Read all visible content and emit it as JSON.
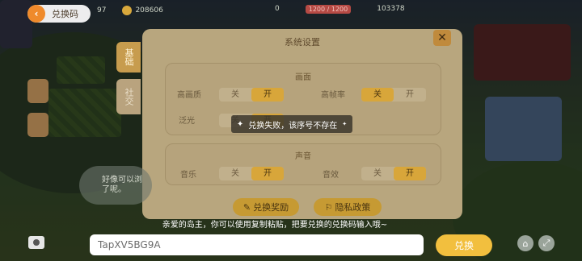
{
  "header": {
    "back_label": "兑换码",
    "level": "97",
    "coins": "208606",
    "stat_a": "0",
    "energy": "1200 / 1200",
    "gems": "103378"
  },
  "side_tabs": [
    "基础",
    "社交"
  ],
  "dialog": {
    "title": "系统设置",
    "close_glyph": "✕",
    "graphics": {
      "section": "画面",
      "rows": [
        {
          "label": "高画质",
          "off": "关",
          "on": "开",
          "selected": "on"
        },
        {
          "label": "高帧率",
          "off": "关",
          "on": "开",
          "selected": "off"
        },
        {
          "label": "泛光",
          "off": "关",
          "on": "开",
          "selected": "on"
        }
      ]
    },
    "sound": {
      "section": "声音",
      "rows": [
        {
          "label": "音乐",
          "off": "关",
          "on": "开",
          "selected": "on"
        },
        {
          "label": "音效",
          "off": "关",
          "on": "开",
          "selected": "on"
        }
      ]
    },
    "buttons": {
      "redeem_rewards": "兑换奖励",
      "privacy": "隐私政策"
    }
  },
  "toast": {
    "text": "兑换失败，该序号不存在"
  },
  "bubble": {
    "line1": "好像可以浏",
    "line2": "了呢。"
  },
  "redeem": {
    "hint": "亲爱的岛主，你可以使用复制粘贴，把要兑换的兑换码输入哦~",
    "code_value": "TapXV5BG9A",
    "button": "兑换"
  },
  "colors": {
    "accent": "#f2bf3e",
    "panel": "#b8a67e",
    "back": "#ef8a2b"
  }
}
